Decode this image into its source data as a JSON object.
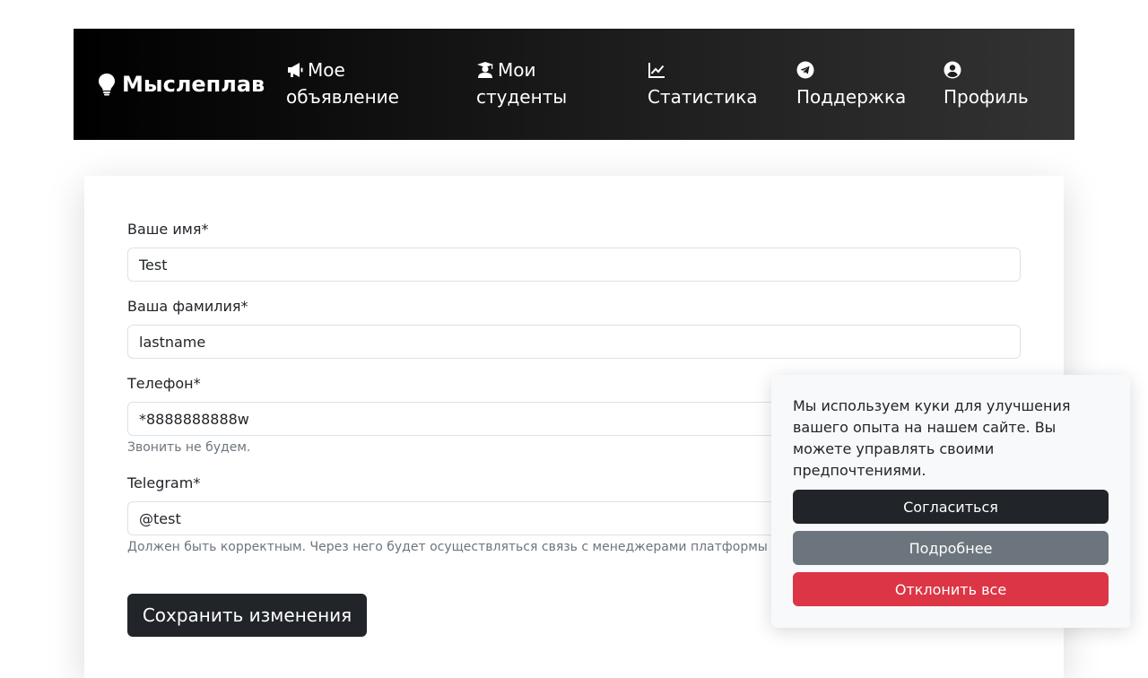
{
  "navbar": {
    "brand": "Мыслеплав",
    "items": [
      {
        "line1": "Мое",
        "line2": "объявление",
        "icon": "megaphone-icon"
      },
      {
        "line1": "Мои",
        "line2": "студенты",
        "icon": "graduate-icon"
      },
      {
        "line1": "",
        "line2": "Статистика",
        "icon": "chart-line-icon"
      },
      {
        "line1": "",
        "line2": "Поддержка",
        "icon": "telegram-icon"
      },
      {
        "line1": "",
        "line2": "Профиль",
        "icon": "user-circle-icon"
      }
    ]
  },
  "form": {
    "first_name": {
      "label": "Ваше имя*",
      "value": "Test"
    },
    "last_name": {
      "label": "Ваша фамилия*",
      "value": "lastname"
    },
    "phone": {
      "label": "Телефон*",
      "value": "*8888888888w",
      "hint": "Звонить не будем."
    },
    "telegram": {
      "label": "Telegram*",
      "value": "@test",
      "hint": "Должен быть корректным. Через него будет осуществляться связь с менеджерами платформы"
    },
    "save_label": "Сохранить изменения"
  },
  "cookie": {
    "text": "Мы используем куки для улучшения вашего опыта на нашем сайте. Вы можете управлять своими предпочтениями.",
    "accept": "Согласиться",
    "more": "Подробнее",
    "reject": "Отклонить все"
  },
  "colors": {
    "primary_dark": "#212529",
    "secondary": "#6c757d",
    "danger": "#dc3545",
    "muted_text": "#6c757d"
  }
}
